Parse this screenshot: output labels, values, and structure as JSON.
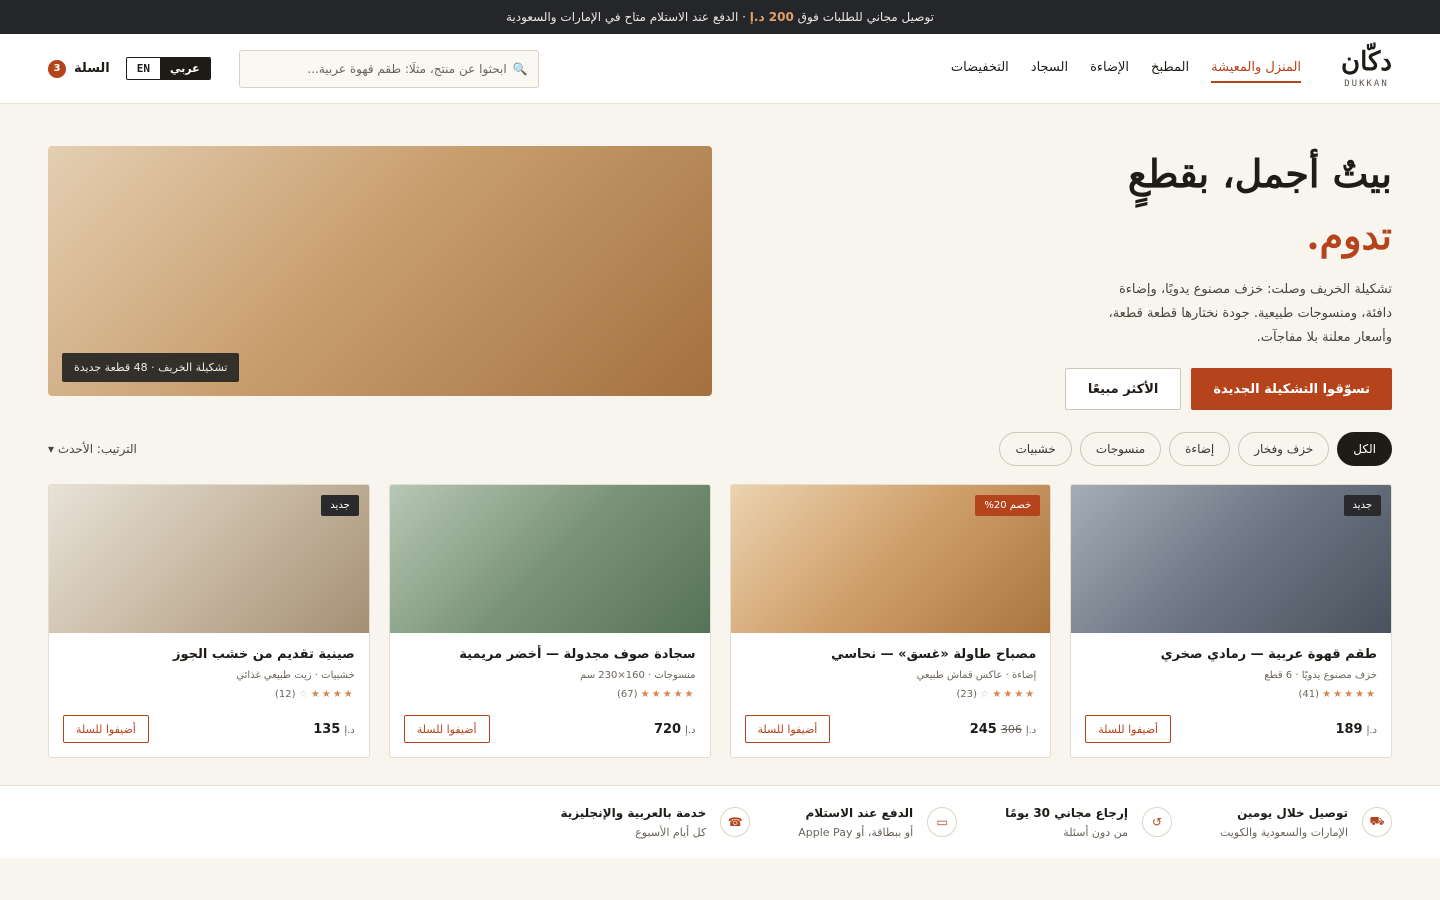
{
  "topbar": {
    "text_before": "توصيل مجاني للطلبات فوق",
    "amount": "200 د.إ",
    "text_after": "· الدفع عند الاستلام متاح في الإمارات والسعودية"
  },
  "header": {
    "logo_ar": "دكّان",
    "logo_en": "DUKKAN",
    "nav": [
      "المنزل والمعيشة",
      "المطبخ",
      "الإضاءة",
      "السجاد",
      "التخفيضات"
    ],
    "search_placeholder": "ابحثوا عن منتج، مثلًا: طقم قهوة عربية...",
    "lang_ar": "عربي",
    "lang_en": "EN",
    "cart_label": "السلة",
    "cart_count": "3",
    "active_nav": "المنزل والمعيشة"
  },
  "hero": {
    "title_line1": "بيتٌ أجمل، بقطعٍ",
    "title_line2": "تدوم.",
    "description": "تشكيلة الخريف وصلت: خزف مصنوع يدويًا، وإضاءة دافئة، ومنسوجات طبيعية. جودة نختارها قطعة قطعة، وأسعار معلنة بلا مفاجآت.",
    "primary_button": "تسوّقوا التشكيلة الجديدة",
    "secondary_button": "الأكثر مبيعًا",
    "image_caption": "تشكيلة الخريف · 48 قطعة جديدة"
  },
  "filters": {
    "chips": [
      "الكل",
      "خزف وفخار",
      "إضاءة",
      "منسوجات",
      "خشبيات"
    ],
    "active": "الكل",
    "sort_label": "الترتيب: الأحدث ▾"
  },
  "products": [
    {
      "tag": "جديد",
      "tag_type": "dark",
      "title": "طقم قهوة عربية — رمادي صخري",
      "meta": "خزف مصنوع يدويًا · 6 قطع",
      "stars": "★★★★★",
      "empty_stars": "",
      "reviews": "(41)",
      "currency": "د.إ",
      "price": "189",
      "old_price": "",
      "button": "أضيفوا للسلة"
    },
    {
      "tag": "خصم 20%",
      "tag_type": "sale",
      "title": "مصباح طاولة «غسق» — نحاسي",
      "meta": "إضاءة · عاكس قماش طبيعي",
      "stars": "★★★★",
      "empty_stars": "☆",
      "reviews": "(23)",
      "currency": "د.إ",
      "price": "245",
      "old_price": "306",
      "button": "أضيفوا للسلة"
    },
    {
      "tag": "",
      "tag_type": "",
      "title": "سجادة صوف مجدولة — أخضر مريمية",
      "meta": "منسوجات · 160×230 سم",
      "stars": "★★★★★",
      "empty_stars": "",
      "reviews": "(67)",
      "currency": "د.إ",
      "price": "720",
      "old_price": "",
      "button": "أضيفوا للسلة"
    },
    {
      "tag": "جديد",
      "tag_type": "dark",
      "title": "صينية تقديم من خشب الجوز",
      "meta": "خشبيات · زيت طبيعي غذائي",
      "stars": "★★★★",
      "empty_stars": "☆",
      "reviews": "(12)",
      "currency": "د.إ",
      "price": "135",
      "old_price": "",
      "button": "أضيفوا للسلة"
    }
  ],
  "features": [
    {
      "icon": "truck-icon",
      "glyph": "⛟",
      "title": "توصيل خلال يومين",
      "subtitle": "الإمارات والسعودية والكويت"
    },
    {
      "icon": "return-icon",
      "glyph": "↺",
      "title": "إرجاع مجاني 30 يومًا",
      "subtitle": "من دون أسئلة"
    },
    {
      "icon": "payment-icon",
      "glyph": "▭",
      "title": "الدفع عند الاستلام",
      "subtitle": "أو ببطاقة، أو Apple Pay"
    },
    {
      "icon": "phone-icon",
      "glyph": "☎",
      "title": "خدمة بالعربية والإنجليزية",
      "subtitle": "كل أيام الأسبوع"
    }
  ],
  "colors": {
    "accent": "#b5441c",
    "dark": "#1f1c18",
    "background": "#f8f5ee",
    "topbar": "#24262a"
  }
}
